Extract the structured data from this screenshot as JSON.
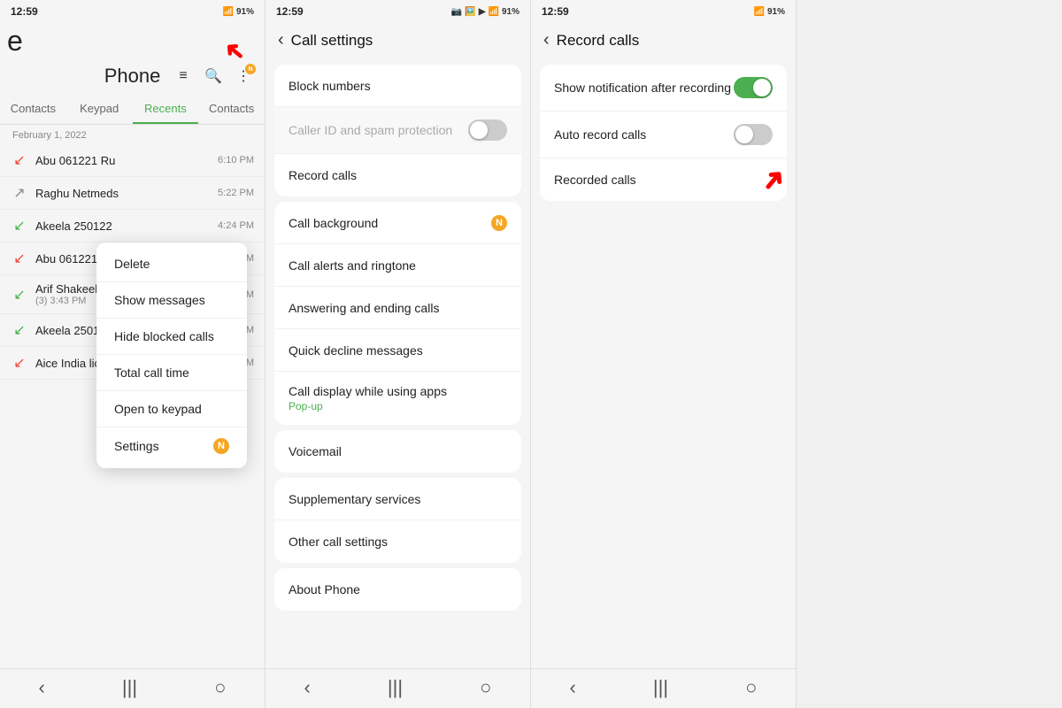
{
  "panel1": {
    "status": {
      "time": "12:59",
      "icons": "📷 🖼️ ▶ 📶 91%"
    },
    "partial_text": "e",
    "title": "Phone",
    "icons": [
      "≡↑",
      "🔍",
      "⋮"
    ],
    "tabs": [
      {
        "label": "Contacts",
        "active": false
      },
      {
        "label": "Keypad",
        "active": false
      },
      {
        "label": "Recents",
        "active": true
      },
      {
        "label": "Contacts",
        "active": false
      }
    ],
    "date": "February 1, 2022",
    "calls": [
      {
        "name": "Abu 061221 Ru",
        "time": "6:10 PM",
        "type": "missed",
        "extra": ""
      },
      {
        "name": "Raghu Netmeds",
        "time": "5:22 PM",
        "type": "outgoing",
        "extra": ""
      },
      {
        "name": "Akeela 250122",
        "time": "4:24 PM",
        "type": "incoming",
        "extra": ""
      },
      {
        "name": "Abu 061221 Ru",
        "time": "4:23 PM",
        "type": "missed",
        "extra": ""
      },
      {
        "name": "Arif Shakeel Haleem 010222",
        "time": "(3) 3:43 PM",
        "type": "incoming",
        "sub": "(3) 3:43 PM",
        "extra": ""
      },
      {
        "name": "Akeela 250122",
        "time": "3:30 PM",
        "type": "incoming",
        "extra": ""
      },
      {
        "name": "Aice India lic 050133 (2)",
        "time": "3:20 PM",
        "type": "missed",
        "extra": ""
      }
    ],
    "context_menu": {
      "items": [
        "Delete",
        "Show messages",
        "Hide blocked calls",
        "Total call time",
        "Open to keypad",
        "Settings"
      ]
    },
    "nav": [
      "‹",
      "|||",
      "○"
    ]
  },
  "panel2": {
    "status": {
      "time": "12:59",
      "icons": "📷 🖼️ ▶ 📶 91%"
    },
    "header": "Call settings",
    "groups": [
      {
        "items": [
          {
            "label": "Block numbers",
            "sub": "",
            "toggle": null,
            "badge": null
          },
          {
            "label": "Caller ID and spam protection",
            "sub": "",
            "toggle": "off",
            "badge": null
          },
          {
            "label": "Record calls",
            "sub": "",
            "toggle": null,
            "badge": null
          }
        ]
      },
      {
        "items": [
          {
            "label": "Call background",
            "sub": "",
            "toggle": null,
            "badge": "N"
          },
          {
            "label": "Call alerts and ringtone",
            "sub": "",
            "toggle": null,
            "badge": null
          },
          {
            "label": "Answering and ending calls",
            "sub": "",
            "toggle": null,
            "badge": null
          },
          {
            "label": "Quick decline messages",
            "sub": "",
            "toggle": null,
            "badge": null
          },
          {
            "label": "Call display while using apps",
            "sub": "Pop-up",
            "toggle": null,
            "badge": null
          }
        ]
      },
      {
        "items": [
          {
            "label": "Voicemail",
            "sub": "",
            "toggle": null,
            "badge": null
          }
        ]
      },
      {
        "items": [
          {
            "label": "Supplementary services",
            "sub": "",
            "toggle": null,
            "badge": null
          },
          {
            "label": "Other call settings",
            "sub": "",
            "toggle": null,
            "badge": null
          }
        ]
      },
      {
        "items": [
          {
            "label": "About Phone",
            "sub": "",
            "toggle": null,
            "badge": null
          }
        ]
      }
    ],
    "nav": [
      "‹",
      "|||",
      "○"
    ]
  },
  "panel3": {
    "status": {
      "time": "12:59",
      "icons": "📷 🖼️ ▶ 📶 91%"
    },
    "header": "Record calls",
    "items": [
      {
        "label": "Show notification after recording",
        "toggle": "on"
      },
      {
        "label": "Auto record calls",
        "toggle": "off"
      },
      {
        "label": "Recorded calls",
        "toggle": null
      }
    ],
    "nav": [
      "‹",
      "|||",
      "○"
    ]
  },
  "icons": {
    "back": "‹",
    "menu": "⋮",
    "search": "🔍",
    "back_arrow": "‹",
    "home": "○",
    "recents": "|||",
    "phone": "☎",
    "call_in": "↙",
    "call_out": "↗",
    "call_missed": "↙"
  }
}
